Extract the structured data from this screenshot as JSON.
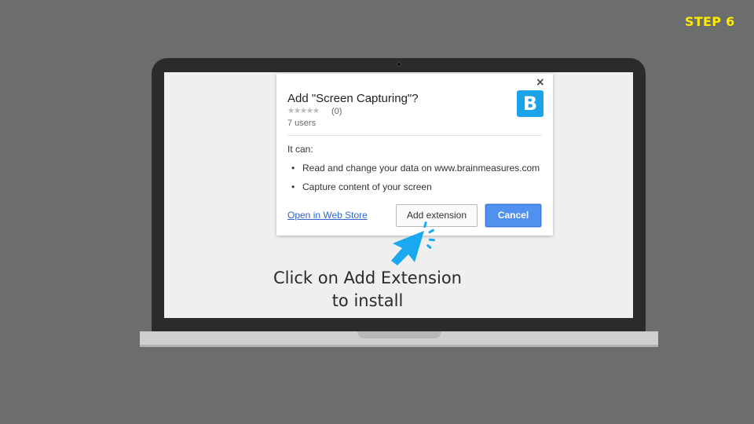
{
  "step_label": "STEP 6",
  "dialog": {
    "title": "Add \"Screen Capturing\"?",
    "rating_stars": "★★★★★",
    "rating_count": "(0)",
    "users": "7 users",
    "logo_letter": "B",
    "close_glyph": "×",
    "permissions_heading": "It can:",
    "permissions": [
      "Read and change your data on www.brainmeasures.com",
      "Capture content of your screen"
    ],
    "bullet": "•",
    "store_link": "Open in Web Store",
    "add_button": "Add extension",
    "cancel_button": "Cancel"
  },
  "instruction": {
    "line1": "Click on Add Extension",
    "line2": "to install"
  },
  "colors": {
    "background": "#6d6d6d",
    "step_label": "#ffeb00",
    "logo": "#1ba3ea",
    "cancel_button": "#5090ef",
    "link": "#3366cc",
    "cursor": "#1aa8f0"
  },
  "icons": {
    "close": "close-icon",
    "cursor": "pointer-cursor-icon",
    "logo": "extension-logo-icon"
  }
}
